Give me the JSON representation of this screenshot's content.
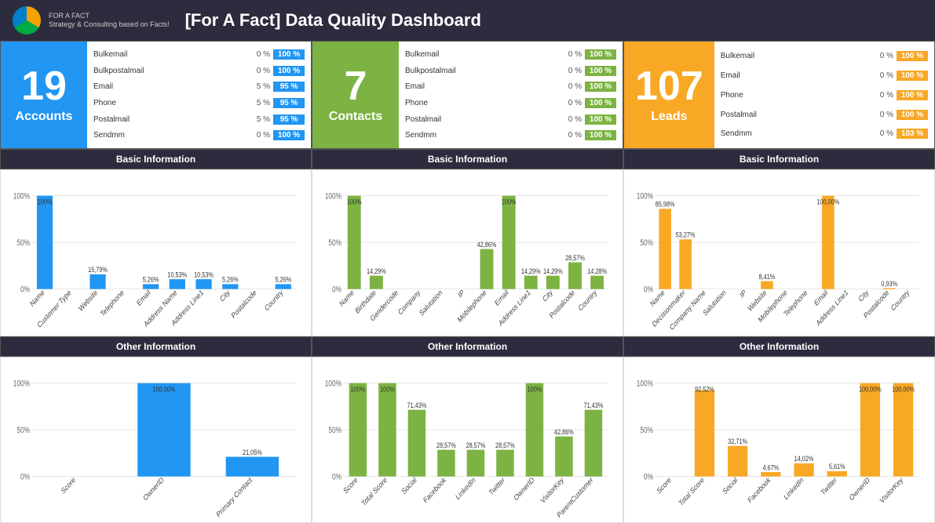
{
  "header": {
    "title": "[For A Fact] Data Quality Dashboard",
    "logo_text": "FOR A FACT",
    "logo_subtext": "Strategy & Consulting based on Facts!"
  },
  "panels": [
    {
      "id": "accounts",
      "color": "blue",
      "number": "19",
      "label": "Accounts",
      "badge_class": "blue-badge",
      "rows": [
        {
          "label": "Bulkemail",
          "pct": "0 %",
          "badge": "100 %"
        },
        {
          "label": "Bulkpostalmail",
          "pct": "0 %",
          "badge": "100 %"
        },
        {
          "label": "Email",
          "pct": "5 %",
          "badge": "95 %"
        },
        {
          "label": "Phone",
          "pct": "5 %",
          "badge": "95 %"
        },
        {
          "label": "Postalmail",
          "pct": "5 %",
          "badge": "95 %"
        },
        {
          "label": "Sendmm",
          "pct": "0 %",
          "badge": "100 %"
        }
      ]
    },
    {
      "id": "contacts",
      "color": "green",
      "number": "7",
      "label": "Contacts",
      "badge_class": "green-badge",
      "rows": [
        {
          "label": "Bulkemail",
          "pct": "0 %",
          "badge": "100 %"
        },
        {
          "label": "Bulkpostalmail",
          "pct": "0 %",
          "badge": "100 %"
        },
        {
          "label": "Email",
          "pct": "0 %",
          "badge": "100 %"
        },
        {
          "label": "Phone",
          "pct": "0 %",
          "badge": "100 %"
        },
        {
          "label": "Postalmail",
          "pct": "0 %",
          "badge": "100 %"
        },
        {
          "label": "Sendmm",
          "pct": "0 %",
          "badge": "100 %"
        }
      ]
    },
    {
      "id": "leads",
      "color": "orange",
      "number": "107",
      "label": "Leads",
      "badge_class": "orange-badge",
      "rows": [
        {
          "label": "Bulkemail",
          "pct": "0 %",
          "badge": "100 %"
        },
        {
          "label": "Email",
          "pct": "0 %",
          "badge": "100 %"
        },
        {
          "label": "Phone",
          "pct": "0 %",
          "badge": "100 %"
        },
        {
          "label": "Postalmail",
          "pct": "0 %",
          "badge": "100 %"
        },
        {
          "label": "Sendmm",
          "pct": "0 %",
          "badge": "103 %"
        }
      ]
    }
  ],
  "sections": {
    "basic_info": "Basic Information",
    "other_info": "Other Information"
  },
  "charts": {
    "accounts_basic": {
      "bars": [
        {
          "label": "Name",
          "value": 100,
          "display": "100%"
        },
        {
          "label": "Customer Type",
          "value": 0,
          "display": ""
        },
        {
          "label": "Website",
          "value": 15.79,
          "display": "15,79%"
        },
        {
          "label": "Telephone",
          "value": 0,
          "display": ""
        },
        {
          "label": "Email",
          "value": 5.26,
          "display": "5,26%"
        },
        {
          "label": "Address Name",
          "value": 10.53,
          "display": "10,53%"
        },
        {
          "label": "Address Line1",
          "value": 10.53,
          "display": "10,53%"
        },
        {
          "label": "City",
          "value": 5.26,
          "display": "5,26%"
        },
        {
          "label": "Postalcode",
          "value": 0,
          "display": ""
        },
        {
          "label": "Country",
          "value": 5.26,
          "display": "5,26%"
        }
      ],
      "color": "#2196F3"
    },
    "contacts_basic": {
      "bars": [
        {
          "label": "Name",
          "value": 100,
          "display": "100%"
        },
        {
          "label": "Birthdate",
          "value": 14.29,
          "display": "14,29%"
        },
        {
          "label": "Gendercode",
          "value": 0,
          "display": ""
        },
        {
          "label": "Company",
          "value": 0,
          "display": ""
        },
        {
          "label": "Salutation",
          "value": 0,
          "display": ""
        },
        {
          "label": "IP",
          "value": 0,
          "display": ""
        },
        {
          "label": "Mobilephone",
          "value": 42.86,
          "display": "42,86%"
        },
        {
          "label": "Email",
          "value": 100,
          "display": "100%"
        },
        {
          "label": "Address Line1",
          "value": 14.29,
          "display": "14,29%"
        },
        {
          "label": "City",
          "value": 14.29,
          "display": "14,29%"
        },
        {
          "label": "Postalcode",
          "value": 28.57,
          "display": "28,57%"
        },
        {
          "label": "Country",
          "value": 14.28,
          "display": "14,28%"
        }
      ],
      "color": "#7CB342"
    },
    "leads_basic": {
      "bars": [
        {
          "label": "Name",
          "value": 85.98,
          "display": "85,98%"
        },
        {
          "label": "Decisionmaker",
          "value": 53.27,
          "display": "53,27%"
        },
        {
          "label": "Company Name",
          "value": 0,
          "display": ""
        },
        {
          "label": "Salutation",
          "value": 0,
          "display": ""
        },
        {
          "label": "IP",
          "value": 0,
          "display": ""
        },
        {
          "label": "Website",
          "value": 8.41,
          "display": "8,41%"
        },
        {
          "label": "Mobilephone",
          "value": 0,
          "display": ""
        },
        {
          "label": "Telephone",
          "value": 0,
          "display": ""
        },
        {
          "label": "Email",
          "value": 100,
          "display": "100,00%"
        },
        {
          "label": "Address Line1",
          "value": 0,
          "display": ""
        },
        {
          "label": "City",
          "value": 0,
          "display": ""
        },
        {
          "label": "Postalcode",
          "value": 0.93,
          "display": "0,93%"
        },
        {
          "label": "Country",
          "value": 0,
          "display": ""
        }
      ],
      "color": "#F9A825"
    },
    "accounts_other": {
      "bars": [
        {
          "label": "Score",
          "value": 0,
          "display": ""
        },
        {
          "label": "OwnerID",
          "value": 100,
          "display": "100,00%"
        },
        {
          "label": "Primary Contact",
          "value": 21.05,
          "display": "21,05%"
        }
      ],
      "color": "#2196F3"
    },
    "contacts_other": {
      "bars": [
        {
          "label": "Score",
          "value": 100,
          "display": "100%"
        },
        {
          "label": "Total Score",
          "value": 100,
          "display": "100%"
        },
        {
          "label": "Social",
          "value": 71.43,
          "display": "71,43%"
        },
        {
          "label": "Facebook",
          "value": 28.57,
          "display": "28,57%"
        },
        {
          "label": "LinkedIn",
          "value": 28.57,
          "display": "28,57%"
        },
        {
          "label": "Twitter",
          "value": 28.57,
          "display": "28,57%"
        },
        {
          "label": "OwnerID",
          "value": 100,
          "display": "100%"
        },
        {
          "label": "VisitorKey",
          "value": 42.86,
          "display": "42,86%"
        },
        {
          "label": "ParentCustomer",
          "value": 71.43,
          "display": "71,43%"
        }
      ],
      "color": "#7CB342"
    },
    "leads_other": {
      "bars": [
        {
          "label": "Score",
          "value": 0,
          "display": ""
        },
        {
          "label": "Total Score",
          "value": 92.52,
          "display": "92,52%"
        },
        {
          "label": "Social",
          "value": 32.71,
          "display": "32,71%"
        },
        {
          "label": "Facebook",
          "value": 4.67,
          "display": "4,67%"
        },
        {
          "label": "LinkedIn",
          "value": 14.02,
          "display": "14,02%"
        },
        {
          "label": "Twitter",
          "value": 5.61,
          "display": "5,61%"
        },
        {
          "label": "OwnerID",
          "value": 100,
          "display": "100,00%"
        },
        {
          "label": "VisitorKey",
          "value": 100,
          "display": "100,00%"
        }
      ],
      "color": "#F9A825"
    }
  }
}
